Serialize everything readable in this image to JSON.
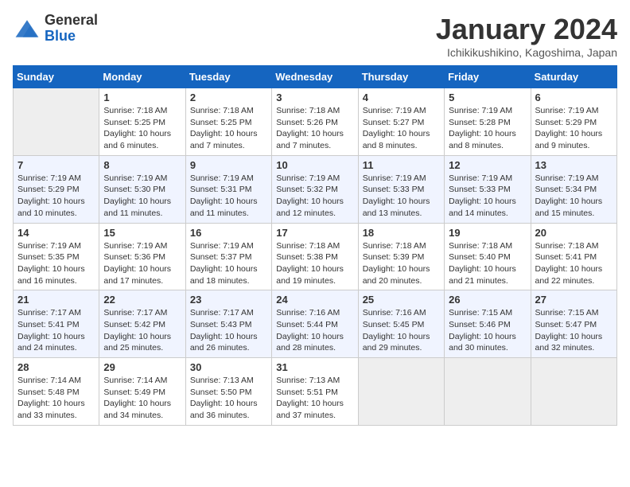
{
  "header": {
    "logo_general": "General",
    "logo_blue": "Blue",
    "title": "January 2024",
    "subtitle": "Ichikikushikino, Kagoshima, Japan"
  },
  "weekdays": [
    "Sunday",
    "Monday",
    "Tuesday",
    "Wednesday",
    "Thursday",
    "Friday",
    "Saturday"
  ],
  "weeks": [
    [
      {
        "day": "",
        "info": ""
      },
      {
        "day": "1",
        "info": "Sunrise: 7:18 AM\nSunset: 5:25 PM\nDaylight: 10 hours\nand 6 minutes."
      },
      {
        "day": "2",
        "info": "Sunrise: 7:18 AM\nSunset: 5:25 PM\nDaylight: 10 hours\nand 7 minutes."
      },
      {
        "day": "3",
        "info": "Sunrise: 7:18 AM\nSunset: 5:26 PM\nDaylight: 10 hours\nand 7 minutes."
      },
      {
        "day": "4",
        "info": "Sunrise: 7:19 AM\nSunset: 5:27 PM\nDaylight: 10 hours\nand 8 minutes."
      },
      {
        "day": "5",
        "info": "Sunrise: 7:19 AM\nSunset: 5:28 PM\nDaylight: 10 hours\nand 8 minutes."
      },
      {
        "day": "6",
        "info": "Sunrise: 7:19 AM\nSunset: 5:29 PM\nDaylight: 10 hours\nand 9 minutes."
      }
    ],
    [
      {
        "day": "7",
        "info": "Sunrise: 7:19 AM\nSunset: 5:29 PM\nDaylight: 10 hours\nand 10 minutes."
      },
      {
        "day": "8",
        "info": "Sunrise: 7:19 AM\nSunset: 5:30 PM\nDaylight: 10 hours\nand 11 minutes."
      },
      {
        "day": "9",
        "info": "Sunrise: 7:19 AM\nSunset: 5:31 PM\nDaylight: 10 hours\nand 11 minutes."
      },
      {
        "day": "10",
        "info": "Sunrise: 7:19 AM\nSunset: 5:32 PM\nDaylight: 10 hours\nand 12 minutes."
      },
      {
        "day": "11",
        "info": "Sunrise: 7:19 AM\nSunset: 5:33 PM\nDaylight: 10 hours\nand 13 minutes."
      },
      {
        "day": "12",
        "info": "Sunrise: 7:19 AM\nSunset: 5:33 PM\nDaylight: 10 hours\nand 14 minutes."
      },
      {
        "day": "13",
        "info": "Sunrise: 7:19 AM\nSunset: 5:34 PM\nDaylight: 10 hours\nand 15 minutes."
      }
    ],
    [
      {
        "day": "14",
        "info": "Sunrise: 7:19 AM\nSunset: 5:35 PM\nDaylight: 10 hours\nand 16 minutes."
      },
      {
        "day": "15",
        "info": "Sunrise: 7:19 AM\nSunset: 5:36 PM\nDaylight: 10 hours\nand 17 minutes."
      },
      {
        "day": "16",
        "info": "Sunrise: 7:19 AM\nSunset: 5:37 PM\nDaylight: 10 hours\nand 18 minutes."
      },
      {
        "day": "17",
        "info": "Sunrise: 7:18 AM\nSunset: 5:38 PM\nDaylight: 10 hours\nand 19 minutes."
      },
      {
        "day": "18",
        "info": "Sunrise: 7:18 AM\nSunset: 5:39 PM\nDaylight: 10 hours\nand 20 minutes."
      },
      {
        "day": "19",
        "info": "Sunrise: 7:18 AM\nSunset: 5:40 PM\nDaylight: 10 hours\nand 21 minutes."
      },
      {
        "day": "20",
        "info": "Sunrise: 7:18 AM\nSunset: 5:41 PM\nDaylight: 10 hours\nand 22 minutes."
      }
    ],
    [
      {
        "day": "21",
        "info": "Sunrise: 7:17 AM\nSunset: 5:41 PM\nDaylight: 10 hours\nand 24 minutes."
      },
      {
        "day": "22",
        "info": "Sunrise: 7:17 AM\nSunset: 5:42 PM\nDaylight: 10 hours\nand 25 minutes."
      },
      {
        "day": "23",
        "info": "Sunrise: 7:17 AM\nSunset: 5:43 PM\nDaylight: 10 hours\nand 26 minutes."
      },
      {
        "day": "24",
        "info": "Sunrise: 7:16 AM\nSunset: 5:44 PM\nDaylight: 10 hours\nand 28 minutes."
      },
      {
        "day": "25",
        "info": "Sunrise: 7:16 AM\nSunset: 5:45 PM\nDaylight: 10 hours\nand 29 minutes."
      },
      {
        "day": "26",
        "info": "Sunrise: 7:15 AM\nSunset: 5:46 PM\nDaylight: 10 hours\nand 30 minutes."
      },
      {
        "day": "27",
        "info": "Sunrise: 7:15 AM\nSunset: 5:47 PM\nDaylight: 10 hours\nand 32 minutes."
      }
    ],
    [
      {
        "day": "28",
        "info": "Sunrise: 7:14 AM\nSunset: 5:48 PM\nDaylight: 10 hours\nand 33 minutes."
      },
      {
        "day": "29",
        "info": "Sunrise: 7:14 AM\nSunset: 5:49 PM\nDaylight: 10 hours\nand 34 minutes."
      },
      {
        "day": "30",
        "info": "Sunrise: 7:13 AM\nSunset: 5:50 PM\nDaylight: 10 hours\nand 36 minutes."
      },
      {
        "day": "31",
        "info": "Sunrise: 7:13 AM\nSunset: 5:51 PM\nDaylight: 10 hours\nand 37 minutes."
      },
      {
        "day": "",
        "info": ""
      },
      {
        "day": "",
        "info": ""
      },
      {
        "day": "",
        "info": ""
      }
    ]
  ]
}
